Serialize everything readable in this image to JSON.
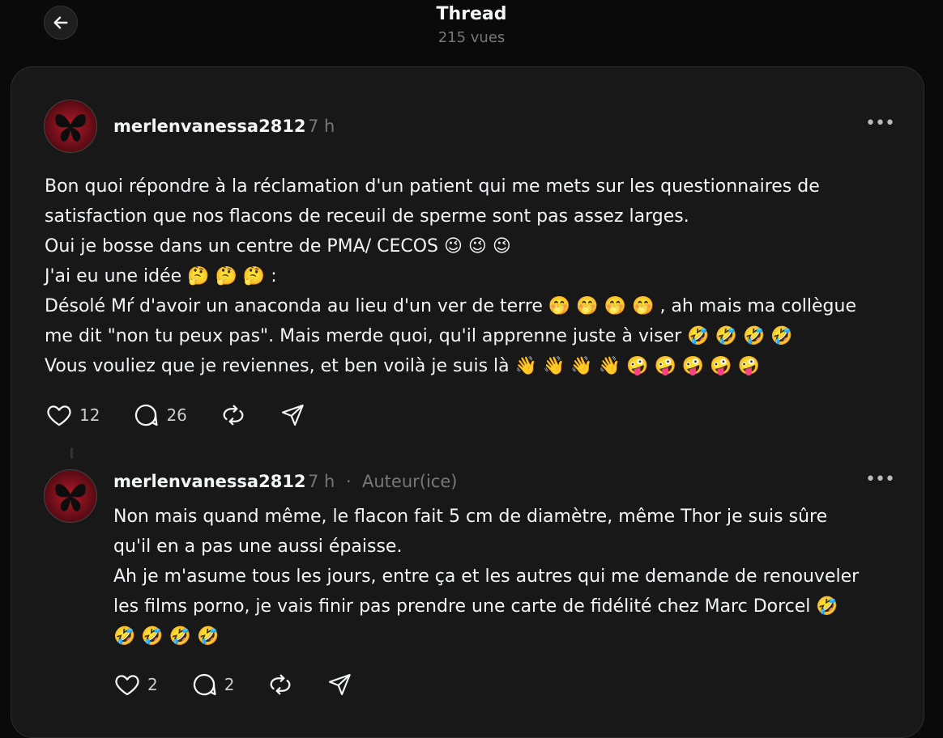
{
  "header": {
    "title": "Thread",
    "views": "215 vues"
  },
  "posts": [
    {
      "username": "merlenvanessa2812",
      "time": "7 h",
      "text": "Bon quoi répondre à la réclamation d'un patient qui me mets sur les questionnaires de\nsatisfaction que nos flacons de receuil de sperme sont pas assez larges.\nOui je bosse dans un centre de PMA/ CECOS 😉 😉 😉\nJ'ai eu une idée 🤔 🤔 🤔 :\nDésolé Mŕ d'avoir un anaconda au lieu d'un ver de terre 🤭 🤭 🤭 🤭 , ah mais ma collègue\nme dit \"non tu peux pas\". Mais merde quoi, qu'il apprenne juste à viser 🤣 🤣 🤣 🤣\nVous vouliez que je reviennes, et ben voilà je suis là 👋 👋 👋 👋 🤪 🤪 🤪 🤪 🤪",
      "likes": "12",
      "replies": "26"
    },
    {
      "username": "merlenvanessa2812",
      "time": "7 h",
      "separator": "·",
      "author_badge": "Auteur(ice)",
      "text": "Non mais quand même, le flacon fait 5 cm de diamètre, même Thor je suis sûre\nqu'il en a pas une aussi épaisse.\nAh je m'asume tous les jours, entre ça et les autres qui me demande de renouveler\nles films porno, je vais finir pas prendre une carte de fidélité chez Marc Dorcel 🤣\n🤣 🤣 🤣 🤣",
      "likes": "2",
      "replies": "2"
    }
  ],
  "icons": {
    "back": "arrow-left-icon",
    "more": "more-horizontal-icon",
    "like": "heart-icon",
    "reply": "comment-icon",
    "repost": "repost-icon",
    "share": "send-icon"
  },
  "colors": {
    "background": "#0a0a0a",
    "card": "#181818",
    "text": "#f3f5f7",
    "muted": "#777777"
  }
}
